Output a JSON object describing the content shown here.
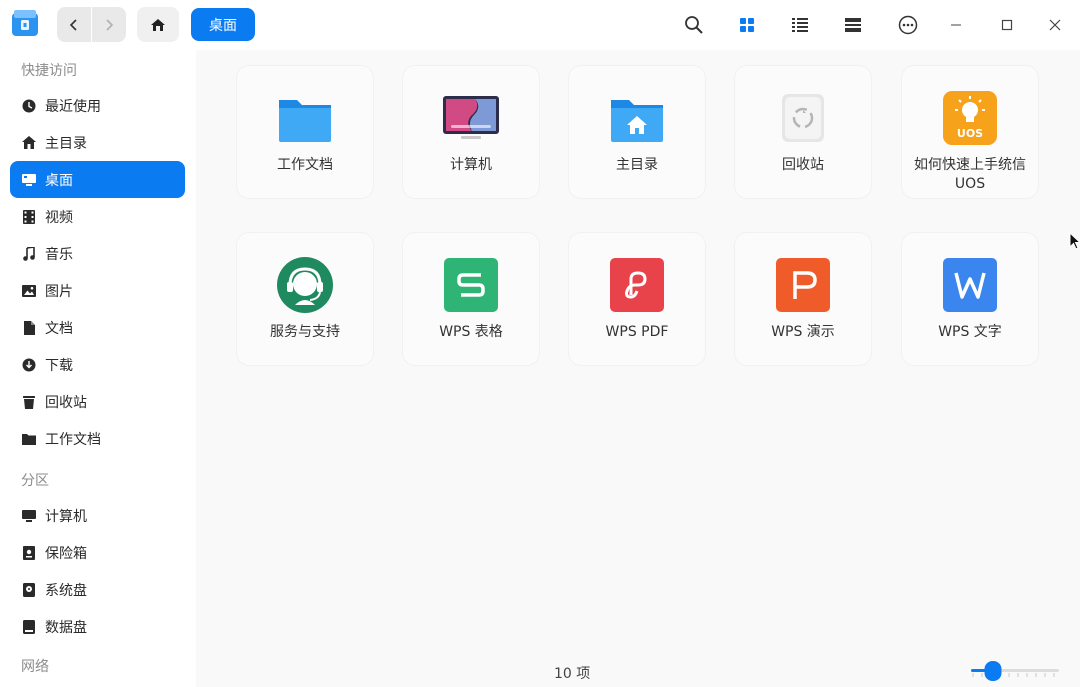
{
  "toolbar": {
    "breadcrumb": "桌面",
    "icons": [
      "back-icon",
      "forward-icon",
      "home-icon",
      "search-icon",
      "icon-view-icon",
      "list-view-icon",
      "tree-view-icon",
      "more-icon",
      "minimize-icon",
      "maximize-icon",
      "close-icon"
    ],
    "accent_color": "#0a7bf0"
  },
  "sidebar": {
    "quick_access_title": "快捷访问",
    "items": [
      {
        "label": "最近使用",
        "icon": "clock-icon"
      },
      {
        "label": "主目录",
        "icon": "home-icon"
      },
      {
        "label": "桌面",
        "icon": "desktop-icon"
      },
      {
        "label": "视频",
        "icon": "video-icon"
      },
      {
        "label": "音乐",
        "icon": "music-icon"
      },
      {
        "label": "图片",
        "icon": "picture-icon"
      },
      {
        "label": "文档",
        "icon": "document-icon"
      },
      {
        "label": "下载",
        "icon": "download-icon"
      },
      {
        "label": "回收站",
        "icon": "trash-icon"
      },
      {
        "label": "工作文档",
        "icon": "folder-icon"
      }
    ],
    "partition_title": "分区",
    "partitions": [
      {
        "label": "计算机",
        "icon": "computer-icon"
      },
      {
        "label": "保险箱",
        "icon": "vault-icon"
      },
      {
        "label": "系统盘",
        "icon": "disk-icon"
      },
      {
        "label": "数据盘",
        "icon": "disk-icon"
      }
    ],
    "network_title": "网络"
  },
  "files": [
    {
      "name": "工作文档",
      "icon": "folder-icon"
    },
    {
      "name": "计算机",
      "icon": "computer-icon"
    },
    {
      "name": "主目录",
      "icon": "home-folder-icon"
    },
    {
      "name": "回收站",
      "icon": "trash-icon"
    },
    {
      "name": "如何快速上手统信UOS",
      "icon": "uos-guide-icon"
    },
    {
      "name": "服务与支持",
      "icon": "support-icon"
    },
    {
      "name": "WPS 表格",
      "icon": "wps-sheet-icon"
    },
    {
      "name": "WPS PDF",
      "icon": "wps-pdf-icon"
    },
    {
      "name": "WPS 演示",
      "icon": "wps-presentation-icon"
    },
    {
      "name": "WPS 文字",
      "icon": "wps-writer-icon"
    }
  ],
  "status": {
    "count": "10 项",
    "zoom_level": 0.25
  }
}
